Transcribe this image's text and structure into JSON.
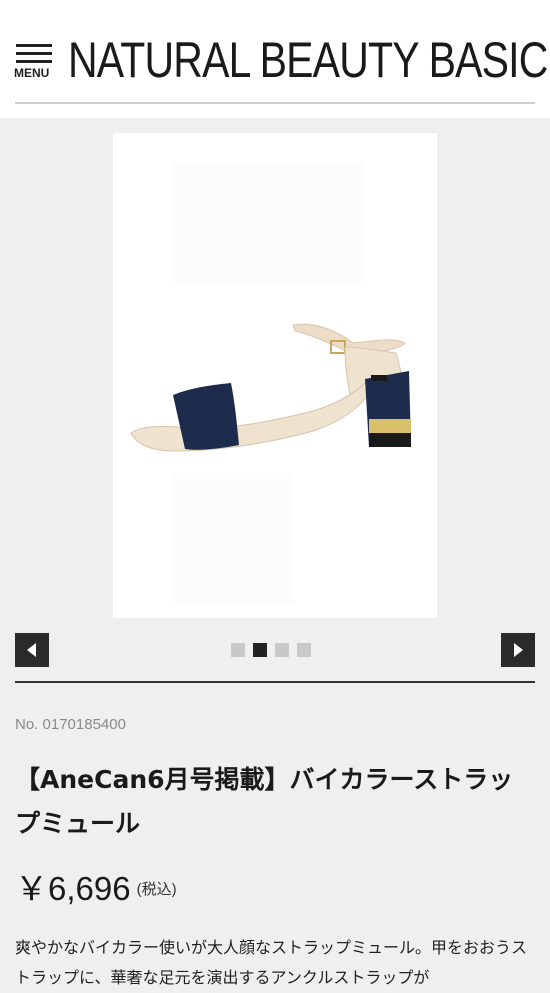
{
  "header": {
    "menu_label": "MENU",
    "logo_text": "NATURAL BEAUTY BASIC"
  },
  "gallery": {
    "image_alt": "navy and beige bicolor strap sandal with block heel",
    "dots_count": 4,
    "active_dot": 2
  },
  "product": {
    "number": "No. 0170185400",
    "title": "【AneCan6月号掲載】バイカラーストラップミュール",
    "price": "￥6,696",
    "tax_label": "(税込)",
    "description": "爽やかなバイカラー使いが大人顔なストラップミュール。甲をおおうストラップに、華奢な足元を演出するアンクルストラップが"
  },
  "colors": {
    "navy": "#1d2b4c",
    "beige": "#ecdcc8",
    "gold": "#d9bf6a"
  }
}
